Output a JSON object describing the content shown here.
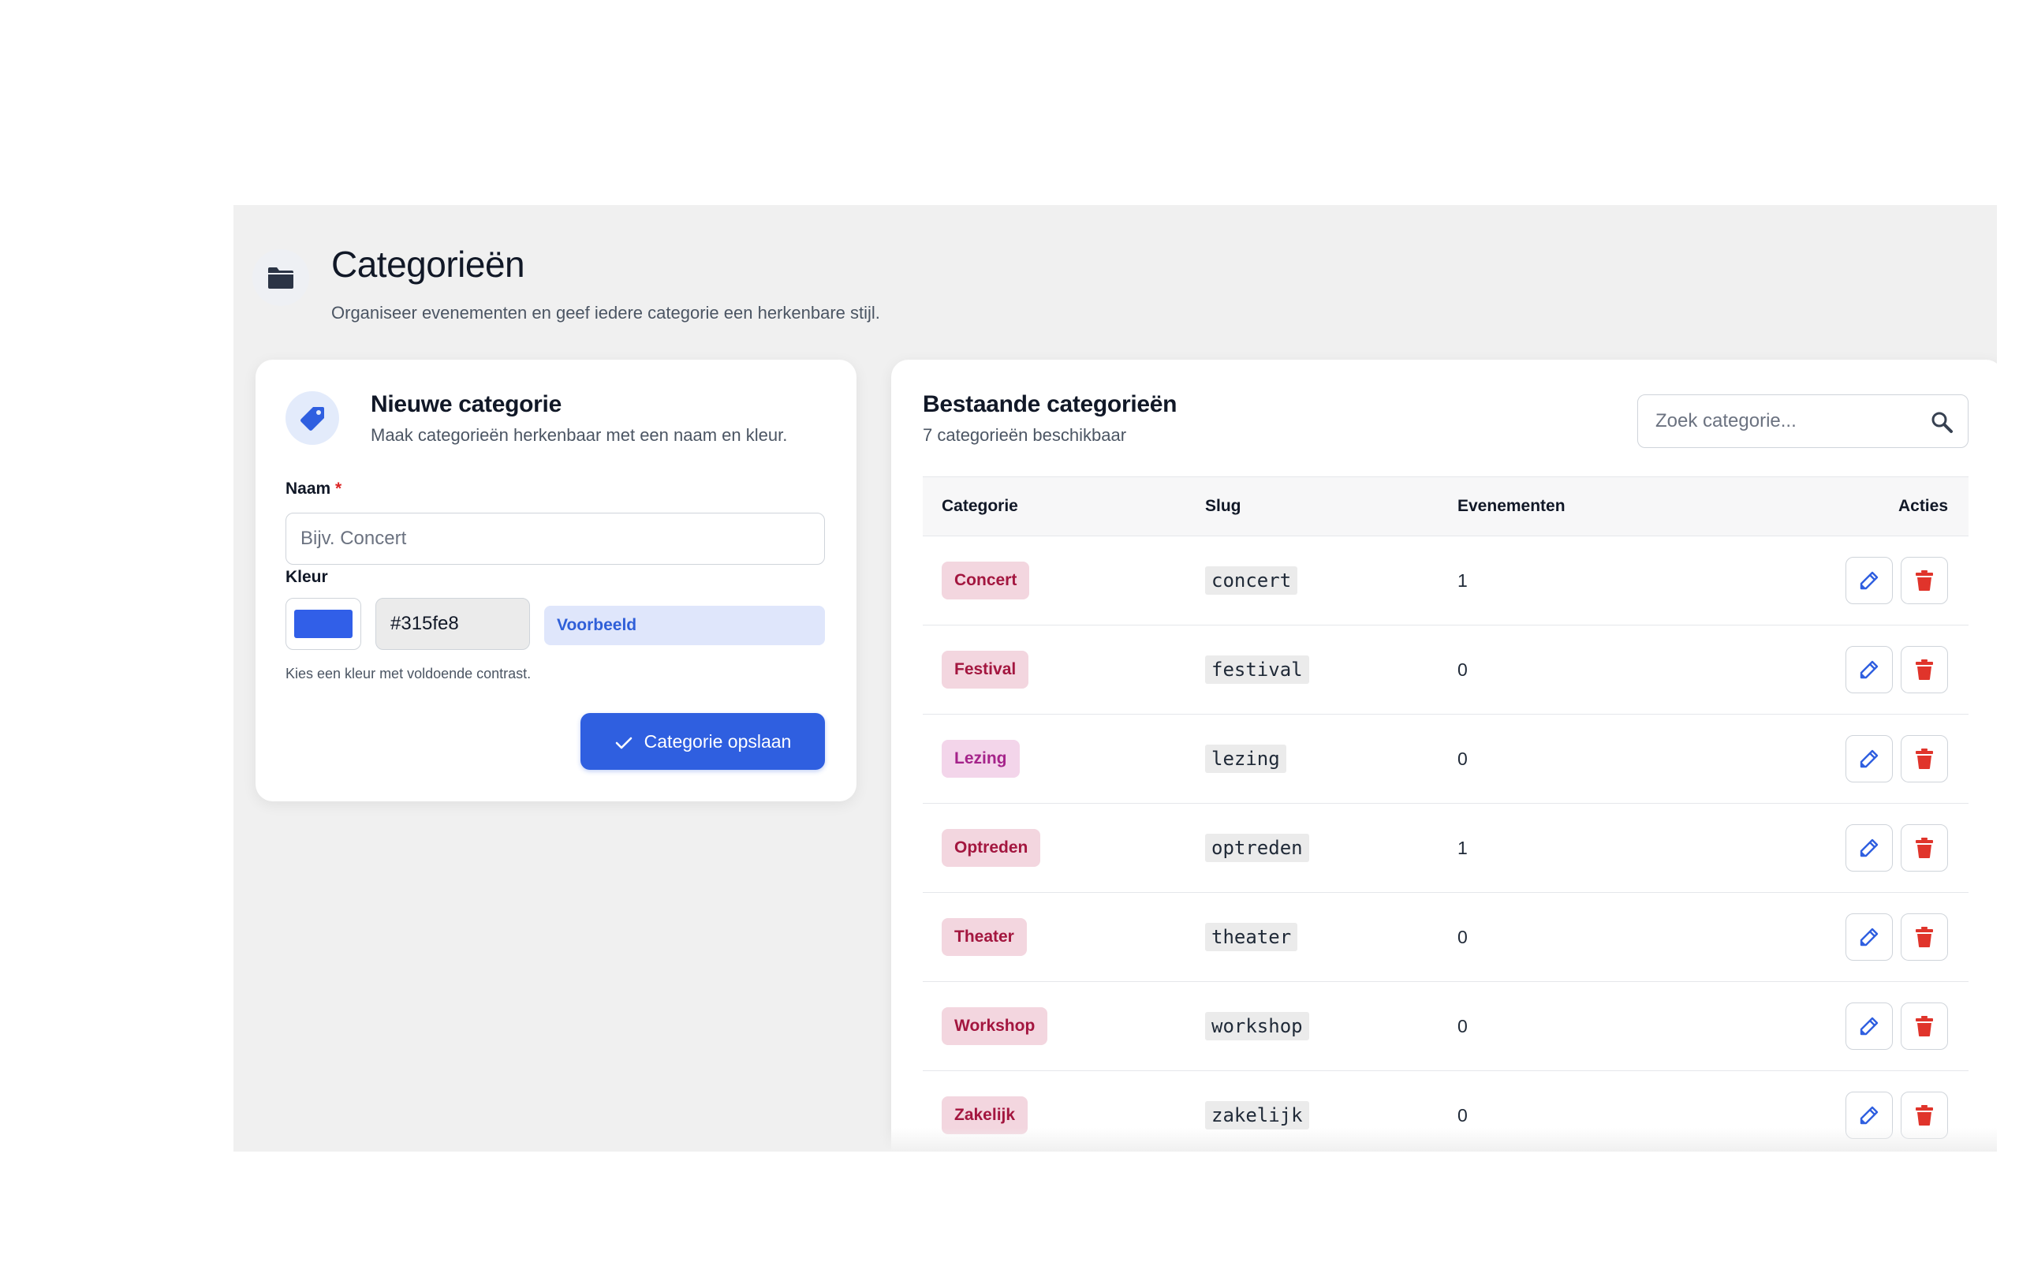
{
  "header": {
    "title": "Categorieën",
    "subtitle": "Organiseer evenementen en geef iedere categorie een herkenbare stijl.",
    "icon": "folder-icon"
  },
  "form": {
    "title": "Nieuwe categorie",
    "subtitle": "Maak categorieën herkenbaar met een naam en kleur.",
    "icon": "tag-icon",
    "name_label": "Naam",
    "required_mark": "*",
    "name_placeholder": "Bijv. Concert",
    "name_value": "",
    "color_label": "Kleur",
    "color_value": "#315fe8",
    "hex_value": "#315fe8",
    "preview_label": "Voorbeeld",
    "help_text": "Kies een kleur met voldoende contrast.",
    "save_label": "Categorie opslaan"
  },
  "list": {
    "title": "Bestaande categorieën",
    "count_text": "7 categorieën beschikbaar",
    "search_placeholder": "Zoek categorie...",
    "columns": {
      "category": "Categorie",
      "slug": "Slug",
      "events": "Evenementen",
      "actions": "Acties"
    },
    "rows": [
      {
        "name": "Concert",
        "slug": "concert",
        "events": "1",
        "bg": "#f3d6df",
        "fg": "#a3163f"
      },
      {
        "name": "Festival",
        "slug": "festival",
        "events": "0",
        "bg": "#f3d6df",
        "fg": "#a3163f"
      },
      {
        "name": "Lezing",
        "slug": "lezing",
        "events": "0",
        "bg": "#f3d5ea",
        "fg": "#a5238a"
      },
      {
        "name": "Optreden",
        "slug": "optreden",
        "events": "1",
        "bg": "#f3d6df",
        "fg": "#a3163f"
      },
      {
        "name": "Theater",
        "slug": "theater",
        "events": "0",
        "bg": "#f3d6df",
        "fg": "#a3163f"
      },
      {
        "name": "Workshop",
        "slug": "workshop",
        "events": "0",
        "bg": "#f3d6df",
        "fg": "#a3163f"
      },
      {
        "name": "Zakelijk",
        "slug": "zakelijk",
        "events": "0",
        "bg": "#f3d6df",
        "fg": "#a3163f"
      }
    ],
    "edit_icon": "pencil-icon",
    "delete_icon": "trash-icon"
  },
  "colors": {
    "accent": "#2f5fe0",
    "danger": "#e0342b"
  }
}
